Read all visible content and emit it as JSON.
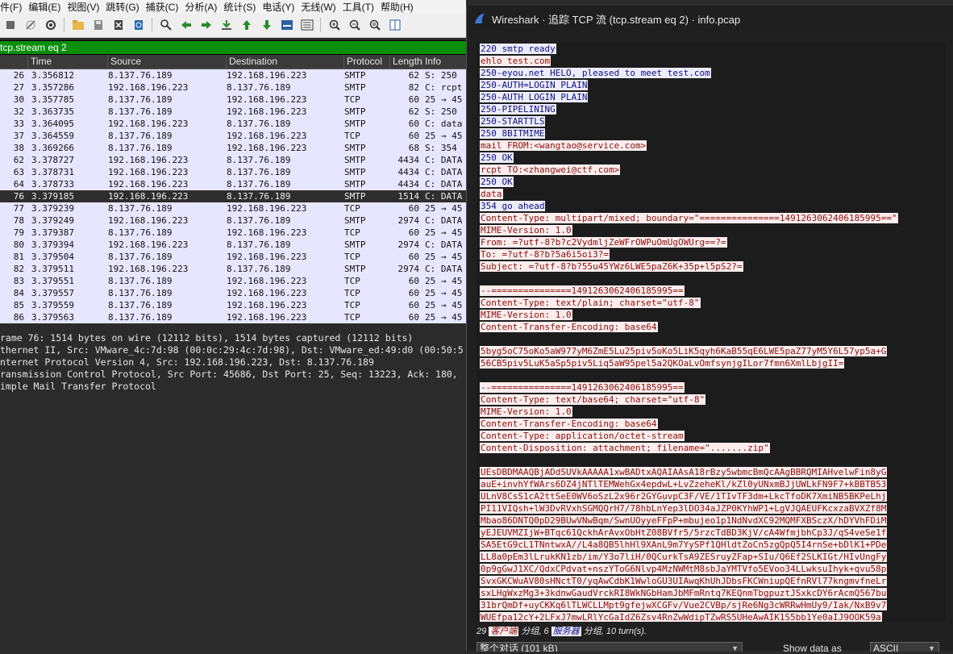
{
  "menu": [
    "件(F)",
    "编辑(E)",
    "视图(V)",
    "跳转(G)",
    "捕获(C)",
    "分析(A)",
    "统计(S)",
    "电话(Y)",
    "无线(W)",
    "工具(T)",
    "帮助(H)"
  ],
  "filter": {
    "value": "tcp.stream eq 2"
  },
  "columns": [
    "",
    "Time",
    "Source",
    "Destination",
    "Protocol",
    "Length",
    "Info"
  ],
  "packets": [
    {
      "no": "26",
      "time": "3.356812",
      "src": "8.137.76.189",
      "dst": "192.168.196.223",
      "proto": "SMTP",
      "len": "62",
      "info": "S: 250"
    },
    {
      "no": "27",
      "time": "3.357286",
      "src": "192.168.196.223",
      "dst": "8.137.76.189",
      "proto": "SMTP",
      "len": "82",
      "info": "C: rcpt"
    },
    {
      "no": "30",
      "time": "3.357785",
      "src": "8.137.76.189",
      "dst": "192.168.196.223",
      "proto": "TCP",
      "len": "60",
      "info": "25 → 45"
    },
    {
      "no": "32",
      "time": "3.363735",
      "src": "8.137.76.189",
      "dst": "192.168.196.223",
      "proto": "SMTP",
      "len": "62",
      "info": "S: 250"
    },
    {
      "no": "33",
      "time": "3.364095",
      "src": "192.168.196.223",
      "dst": "8.137.76.189",
      "proto": "SMTP",
      "len": "60",
      "info": "C: data"
    },
    {
      "no": "37",
      "time": "3.364559",
      "src": "8.137.76.189",
      "dst": "192.168.196.223",
      "proto": "TCP",
      "len": "60",
      "info": "25 → 45"
    },
    {
      "no": "38",
      "time": "3.369266",
      "src": "8.137.76.189",
      "dst": "192.168.196.223",
      "proto": "SMTP",
      "len": "68",
      "info": "S: 354"
    },
    {
      "no": "62",
      "time": "3.378727",
      "src": "192.168.196.223",
      "dst": "8.137.76.189",
      "proto": "SMTP",
      "len": "4434",
      "info": "C: DATA"
    },
    {
      "no": "63",
      "time": "3.378731",
      "src": "192.168.196.223",
      "dst": "8.137.76.189",
      "proto": "SMTP",
      "len": "4434",
      "info": "C: DATA"
    },
    {
      "no": "64",
      "time": "3.378733",
      "src": "192.168.196.223",
      "dst": "8.137.76.189",
      "proto": "SMTP",
      "len": "4434",
      "info": "C: DATA"
    },
    {
      "no": "76",
      "time": "3.379185",
      "src": "192.168.196.223",
      "dst": "8.137.76.189",
      "proto": "SMTP",
      "len": "1514",
      "info": "C: DATA",
      "selected": true
    },
    {
      "no": "77",
      "time": "3.379239",
      "src": "8.137.76.189",
      "dst": "192.168.196.223",
      "proto": "TCP",
      "len": "60",
      "info": "25 → 45"
    },
    {
      "no": "78",
      "time": "3.379249",
      "src": "192.168.196.223",
      "dst": "8.137.76.189",
      "proto": "SMTP",
      "len": "2974",
      "info": "C: DATA"
    },
    {
      "no": "79",
      "time": "3.379387",
      "src": "8.137.76.189",
      "dst": "192.168.196.223",
      "proto": "TCP",
      "len": "60",
      "info": "25 → 45"
    },
    {
      "no": "80",
      "time": "3.379394",
      "src": "192.168.196.223",
      "dst": "8.137.76.189",
      "proto": "SMTP",
      "len": "2974",
      "info": "C: DATA"
    },
    {
      "no": "81",
      "time": "3.379504",
      "src": "8.137.76.189",
      "dst": "192.168.196.223",
      "proto": "TCP",
      "len": "60",
      "info": "25 → 45"
    },
    {
      "no": "82",
      "time": "3.379511",
      "src": "192.168.196.223",
      "dst": "8.137.76.189",
      "proto": "SMTP",
      "len": "2974",
      "info": "C: DATA"
    },
    {
      "no": "83",
      "time": "3.379551",
      "src": "8.137.76.189",
      "dst": "192.168.196.223",
      "proto": "TCP",
      "len": "60",
      "info": "25 → 45"
    },
    {
      "no": "84",
      "time": "3.379557",
      "src": "8.137.76.189",
      "dst": "192.168.196.223",
      "proto": "TCP",
      "len": "60",
      "info": "25 → 45"
    },
    {
      "no": "85",
      "time": "3.379559",
      "src": "8.137.76.189",
      "dst": "192.168.196.223",
      "proto": "TCP",
      "len": "60",
      "info": "25 → 45"
    },
    {
      "no": "86",
      "time": "3.379563",
      "src": "8.137.76.189",
      "dst": "192.168.196.223",
      "proto": "TCP",
      "len": "60",
      "info": "25 → 45"
    }
  ],
  "details": [
    "rame 76: 1514 bytes on wire (12112 bits), 1514 bytes captured (12112 bits)",
    "thernet II, Src: VMware_4c:7d:98 (00:0c:29:4c:7d:98), Dst: VMware_ed:49:d0 (00:50:5",
    "nternet Protocol Version 4, Src: 192.168.196.223, Dst: 8.137.76.189",
    "ransmission Control Protocol, Src Port: 45686, Dst Port: 25, Seq: 13223, Ack: 180,",
    "imple Mail Transfer Protocol"
  ],
  "follow": {
    "title": "Wireshark · 追踪 TCP 流 (tcp.stream eq 2) · info.pcap",
    "lines": [
      {
        "t": "s",
        "x": "220 smtp ready"
      },
      {
        "t": "c",
        "x": "ehlo test.com"
      },
      {
        "t": "s",
        "x": "250-eyou.net HELO, pleased to meet test.com"
      },
      {
        "t": "s",
        "x": "250-AUTH=LOGIN PLAIN"
      },
      {
        "t": "s",
        "x": "250-AUTH LOGIN PLAIN"
      },
      {
        "t": "s",
        "x": "250-PIPELINING"
      },
      {
        "t": "s",
        "x": "250-STARTTLS"
      },
      {
        "t": "s",
        "x": "250 8BITMIME"
      },
      {
        "t": "c",
        "x": "mail FROM:<wangtao@service.com>"
      },
      {
        "t": "s",
        "x": "250 OK"
      },
      {
        "t": "c",
        "x": "rcpt TO:<zhangwei@ctf.com>"
      },
      {
        "t": "s",
        "x": "250 OK"
      },
      {
        "t": "c",
        "x": "data"
      },
      {
        "t": "s",
        "x": "354 go ahead"
      },
      {
        "t": "c",
        "x": "Content-Type: multipart/mixed; boundary=\"===============1491263062406185995==\""
      },
      {
        "t": "c",
        "x": "MIME-Version: 1.0"
      },
      {
        "t": "c",
        "x": "From: =?utf-8?b?c2VydmljZeWFrOWPuOmUgOWUrg==?="
      },
      {
        "t": "c",
        "x": "To: =?utf-8?b?5a6i5oi3?="
      },
      {
        "t": "c",
        "x": "Subject: =?utf-8?b?55u45YWz6LWE5paZ6K+35p+l5pS2?="
      },
      {
        "t": "b",
        "x": ""
      },
      {
        "t": "c",
        "x": "--===============1491263062406185995=="
      },
      {
        "t": "c",
        "x": "Content-Type: text/plain; charset=\"utf-8\""
      },
      {
        "t": "c",
        "x": "MIME-Version: 1.0"
      },
      {
        "t": "c",
        "x": "Content-Transfer-Encoding: base64"
      },
      {
        "t": "b",
        "x": ""
      },
      {
        "t": "c",
        "x": "5byg5oC75oKo5aW977yM6ZmE5Lu25piv5oKo5LiK5qyh6KaB55qE6LWE5paZ77yM5Y6L57yp5a+G"
      },
      {
        "t": "c",
        "x": "56CB5piv5LuK5aSp5piv5Liq5aW95pel5a2QKOaLvOmfsynjgILor7fmn6XmlLbjgII="
      },
      {
        "t": "b",
        "x": ""
      },
      {
        "t": "c",
        "x": "--===============1491263062406185995=="
      },
      {
        "t": "c",
        "x": "Content-Type: text/base64; charset=\"utf-8\""
      },
      {
        "t": "c",
        "x": "MIME-Version: 1.0"
      },
      {
        "t": "c",
        "x": "Content-Transfer-Encoding: base64"
      },
      {
        "t": "c",
        "x": "Content-Type: application/octet-stream"
      },
      {
        "t": "c",
        "x": "Content-Disposition: attachment; filename=\".......zip\""
      },
      {
        "t": "b",
        "x": ""
      },
      {
        "t": "c",
        "x": "UEsDBDMAAQBjADdSUVkAAAAA1xwBADtxAQAIAAsA18rBzy5wbmcBmQcAAgBBRQMIAHvelwFin8yG"
      },
      {
        "t": "c",
        "x": "auE+invhYfWArs6DZ4jNTlTEMWehGx4epdwL+LvZzeheKl/kZl0yUNxmBJjUWLkFN9F7+kBBTB53"
      },
      {
        "t": "c",
        "x": "ULnV8CsS1cA2ttSeE0WV6oSzL2x96r2GYGuvpC3F/VE/1TIvTF3dm+LkcTfoDK7XmiNB5BKPeLhj"
      },
      {
        "t": "c",
        "x": "PI11VIQsh+lW3DvRVxhSGMQQrH7/78hbLnYep3lDO34aJZP0KYhWP1+LgVJQAEUFKcxzaBVXZf8M"
      },
      {
        "t": "c",
        "x": "Mbao86DNTQ0pD29BUwVNwBqm/SwnUOyyeFFpP+mbujeo1p1NdNvdXC92MQMFXBSczX/hDYVhFDiM"
      },
      {
        "t": "c",
        "x": "yEJEUVMZIjW+BTqc61QckhArAvxObHtZ08BVfr5/5rzcTdBD3KjV/cA4WfmjbhCp3J/qS4veSe1f"
      },
      {
        "t": "c",
        "x": "SA5EtG9cL1TNntwxA//L4a8QB5lhHl9XAnL9m7YySPf1QHldtZoCn5zgQpQ5I4rnSe+bDlK1+PDe"
      },
      {
        "t": "c",
        "x": "LL8a0pEm3lLrukKN1zb/im/Y3o7liH/0QCurkTsA9ZESruyZFap+SIu/Q6Ef2SLKIGt/HIvUngFy"
      },
      {
        "t": "c",
        "x": "0p9gGwJ1XC/QdxCPdvat+nszYToG6Nlvp4MzNWMtM8sbJaYMTVfo5EVoo34LLwksuIhyk+qvu58p"
      },
      {
        "t": "c",
        "x": "SvxGKCWuAV80sHNctT0/yqAwCdbK1WwloGU3UIAwqKhUhJDbsFKCWniupQEfnRVl77kngmvfneLr"
      },
      {
        "t": "c",
        "x": "sxLHgWxzMg3+3kdnwGaudVrckRI8WkNGbHamJbMFmRntq7KEQnmTbgpuztJSxkcDY6rAcmQ567bu"
      },
      {
        "t": "c",
        "x": "31brQmDf+uyCKKq6lTLWCLLMpt9gfejwXCGFv/Vue2CVBp/sjRe6Ng3cWRRwHmUy9/Iak/NxB9v7"
      },
      {
        "t": "c",
        "x": "WUEfpa12cY+2LFxJ7mwLRlYcGaIdZ6Zsv4RnZwWdipTZwRS5UHeAwAIK1S5bb1Ye0aIJ9OOK59a"
      }
    ],
    "status_prefix": "29",
    "status_client": "客户端",
    "status_mid1": "分组, 6",
    "status_server": "服务器",
    "status_mid2": "分组, 10 turn(s).",
    "conversation": "整个对话 (101 kB)",
    "show_data_label": "Show data as",
    "show_data_value": "ASCII"
  }
}
